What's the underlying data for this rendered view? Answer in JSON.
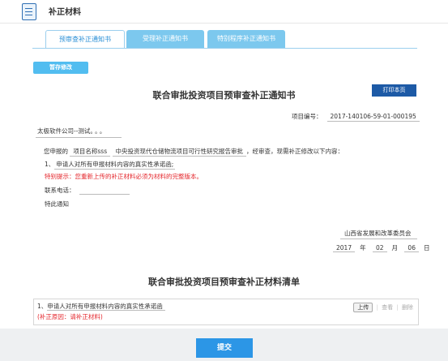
{
  "header": {
    "title": "补正材料"
  },
  "tabs": [
    {
      "label": "预审查补正通知书",
      "active": true
    },
    {
      "label": "受理补正通知书",
      "active": false
    },
    {
      "label": "特别程序补正通知书",
      "active": false
    }
  ],
  "toolbar": {
    "save_label": "暂存修改",
    "print_label": "打印本页"
  },
  "notice": {
    "title": "联合审批投资项目预审查补正通知书",
    "project_no_label": "项目编号：",
    "project_no": "2017-140106-59-01-000195",
    "company": "太极软件公司--测试",
    "company_suffix": "。。。",
    "line1_prefix": "您申报的",
    "line1_project": "项目名称sss",
    "line1_name": "中央投资现代仓储物流项目可行性研究报告审批",
    "line1_suffix": "，经审查，现需补正修改以下内容：",
    "item1_prefix": "1、",
    "item1_text": "申请人对所有申报材料内容的真实性承诺函;",
    "tip": "特别提示：您重新上传的补正材料必须为材料的完整版本。",
    "contact_label": "联系电话：",
    "closing": "特此通知",
    "agency": "山西省发展和改革委员会",
    "date": {
      "year": "2017",
      "month": "02",
      "day": "06",
      "y": "年",
      "m": "月",
      "d": "日"
    }
  },
  "list": {
    "title": "联合审批投资项目预审查补正材料清单",
    "item_prefix": "1、",
    "item": "申请人对所有申报材料内容的真实性承诺函",
    "reason": "(补正原因：请补正材料)",
    "upload": "上传",
    "view": "查看",
    "delete": "删除"
  },
  "footer": {
    "submit_label": "提交"
  }
}
